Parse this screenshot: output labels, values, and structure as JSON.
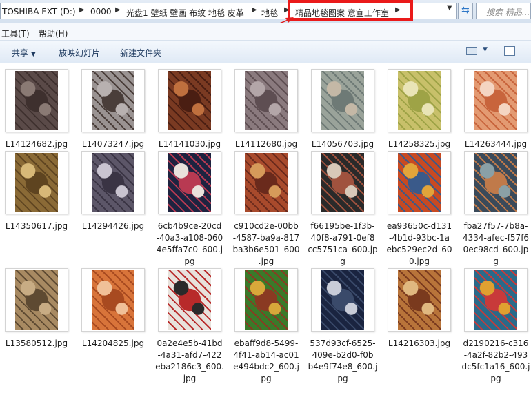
{
  "address": {
    "crumbs": [
      "TOSHIBA EXT (D:)",
      "0000",
      "光盘1 壁纸 壁画 布纹 地毯 皮革",
      "地毯",
      "精品地毯图案 意宣工作室"
    ],
    "search_placeholder": "搜索 精品..."
  },
  "menu": {
    "items": [
      "工具(T)",
      "帮助(H)"
    ]
  },
  "toolbar": {
    "share": "共享",
    "slideshow": "放映幻灯片",
    "new_folder": "新建文件夹"
  },
  "files": [
    {
      "name": "L14124682.jpg",
      "caption_lines": [
        "L14124682.jpg"
      ],
      "colors": [
        "#5a4a48",
        "#8a7a74",
        "#3e302e"
      ]
    },
    {
      "name": "L14073247.jpg",
      "caption_lines": [
        "L14073247.jpg"
      ],
      "colors": [
        "#9a9392",
        "#b8b1b0",
        "#4a3e3a"
      ]
    },
    {
      "name": "L14141030.jpg",
      "caption_lines": [
        "L14141030.jpg"
      ],
      "colors": [
        "#7a3a22",
        "#c0703e",
        "#4a1e12"
      ]
    },
    {
      "name": "L14112680.jpg",
      "caption_lines": [
        "L14112680.jpg"
      ],
      "colors": [
        "#8a7a7e",
        "#b3a6a8",
        "#5e4e52"
      ]
    },
    {
      "name": "L14056703.jpg",
      "caption_lines": [
        "L14056703.jpg"
      ],
      "colors": [
        "#9aa39a",
        "#c4b8a6",
        "#6e7a76"
      ]
    },
    {
      "name": "L14258325.jpg",
      "caption_lines": [
        "L14258325.jpg"
      ],
      "colors": [
        "#c8c06a",
        "#e9e4b6",
        "#9ea346"
      ]
    },
    {
      "name": "L14263444.jpg",
      "caption_lines": [
        "L14263444.jpg"
      ],
      "colors": [
        "#e39a72",
        "#f4d5c2",
        "#c8643c"
      ]
    },
    {
      "name": "L14350617.jpg",
      "caption_lines": [
        "L14350617.jpg"
      ],
      "colors": [
        "#8a6a36",
        "#d7b878",
        "#5e4420"
      ]
    },
    {
      "name": "L14294426.jpg",
      "caption_lines": [
        "L14294426.jpg"
      ],
      "colors": [
        "#5c5668",
        "#c9c4d0",
        "#3a3444"
      ]
    },
    {
      "name": "6cb4b9ce-20cd-40a3-a108-0604e5ffa7c0_600.jpg",
      "caption_lines": [
        "6cb4b9ce-20cd",
        "-40a3-a108-060",
        "4e5ffa7c0_600.j",
        "pg"
      ],
      "colors": [
        "#1d2340",
        "#e9e2dc",
        "#b83a52"
      ]
    },
    {
      "name": "c910cd2e-00bb-4587-ba9a-817ba3b6e501_600.jpg",
      "caption_lines": [
        "c910cd2e-00bb",
        "-4587-ba9a-817",
        "ba3b6e501_600",
        ".jpg"
      ],
      "colors": [
        "#a84a2c",
        "#d69a5a",
        "#6a2a1c"
      ]
    },
    {
      "name": "f66195be-1f3b-40f8-a791-0ef8cc5751ca_600.jpg",
      "caption_lines": [
        "f66195be-1f3b-",
        "40f8-a791-0ef8",
        "cc5751ca_600.jp",
        "g"
      ],
      "colors": [
        "#2a2a2a",
        "#d8c8b8",
        "#a0523e"
      ]
    },
    {
      "name": "ea93650c-d131-4b1d-93bc-1aebc529ec2d_600.jpg",
      "caption_lines": [
        "ea93650c-d131",
        "-4b1d-93bc-1a",
        "ebc529ec2d_60",
        "0.jpg"
      ],
      "colors": [
        "#c84a22",
        "#e2a43a",
        "#3a5a8a"
      ]
    },
    {
      "name": "fba27f57-7b8a-4334-afec-f57f60ec98cd_600.jpg",
      "caption_lines": [
        "fba27f57-7b8a-",
        "4334-afec-f57f6",
        "0ec98cd_600.jp",
        "g"
      ],
      "colors": [
        "#3a4a5a",
        "#8aa0a6",
        "#c07a4a"
      ]
    },
    {
      "name": "L13580512.jpg",
      "caption_lines": [
        "L13580512.jpg"
      ],
      "colors": [
        "#a88a62",
        "#c8ac84",
        "#5e4a32"
      ]
    },
    {
      "name": "L14204825.jpg",
      "caption_lines": [
        "L14204825.jpg"
      ],
      "colors": [
        "#d8743a",
        "#f0c098",
        "#a84a20"
      ]
    },
    {
      "name": "0a2e4e5b-41bd-4a31-afd7-422eba2186c3_600.jpg",
      "caption_lines": [
        "0a2e4e5b-41bd",
        "-4a31-afd7-422",
        "eba2186c3_600.",
        "jpg"
      ],
      "colors": [
        "#e8e2dc",
        "#2a2a2a",
        "#b82a2a"
      ]
    },
    {
      "name": "ebaff9d8-5499-4f41-ab14-ac01e494bdc2_600.jpg",
      "caption_lines": [
        "ebaff9d8-5499-",
        "4f41-ab14-ac01",
        "e494bdc2_600.j",
        "pg"
      ],
      "colors": [
        "#3a7a2a",
        "#d8a83a",
        "#8a3a22"
      ]
    },
    {
      "name": "537d93cf-6525-409e-b2d0-f0bb4e9f74e8_600.jpg",
      "caption_lines": [
        "537d93cf-6525-",
        "409e-b2d0-f0b",
        "b4e9f74e8_600.j",
        "pg"
      ],
      "colors": [
        "#1a2440",
        "#c8ccd8",
        "#3a4a6a"
      ]
    },
    {
      "name": "L14216303.jpg",
      "caption_lines": [
        "L14216303.jpg"
      ],
      "colors": [
        "#b8743a",
        "#e0b880",
        "#7a3a1e"
      ]
    },
    {
      "name": "d2190216-c316-4a2f-82b2-493dc5fc1a16_600.jpg",
      "caption_lines": [
        "d2190216-c316",
        "-4a2f-82b2-493",
        "dc5fc1a16_600.j",
        "pg"
      ],
      "colors": [
        "#2a6a8a",
        "#e0a030",
        "#c83a3a"
      ]
    }
  ]
}
